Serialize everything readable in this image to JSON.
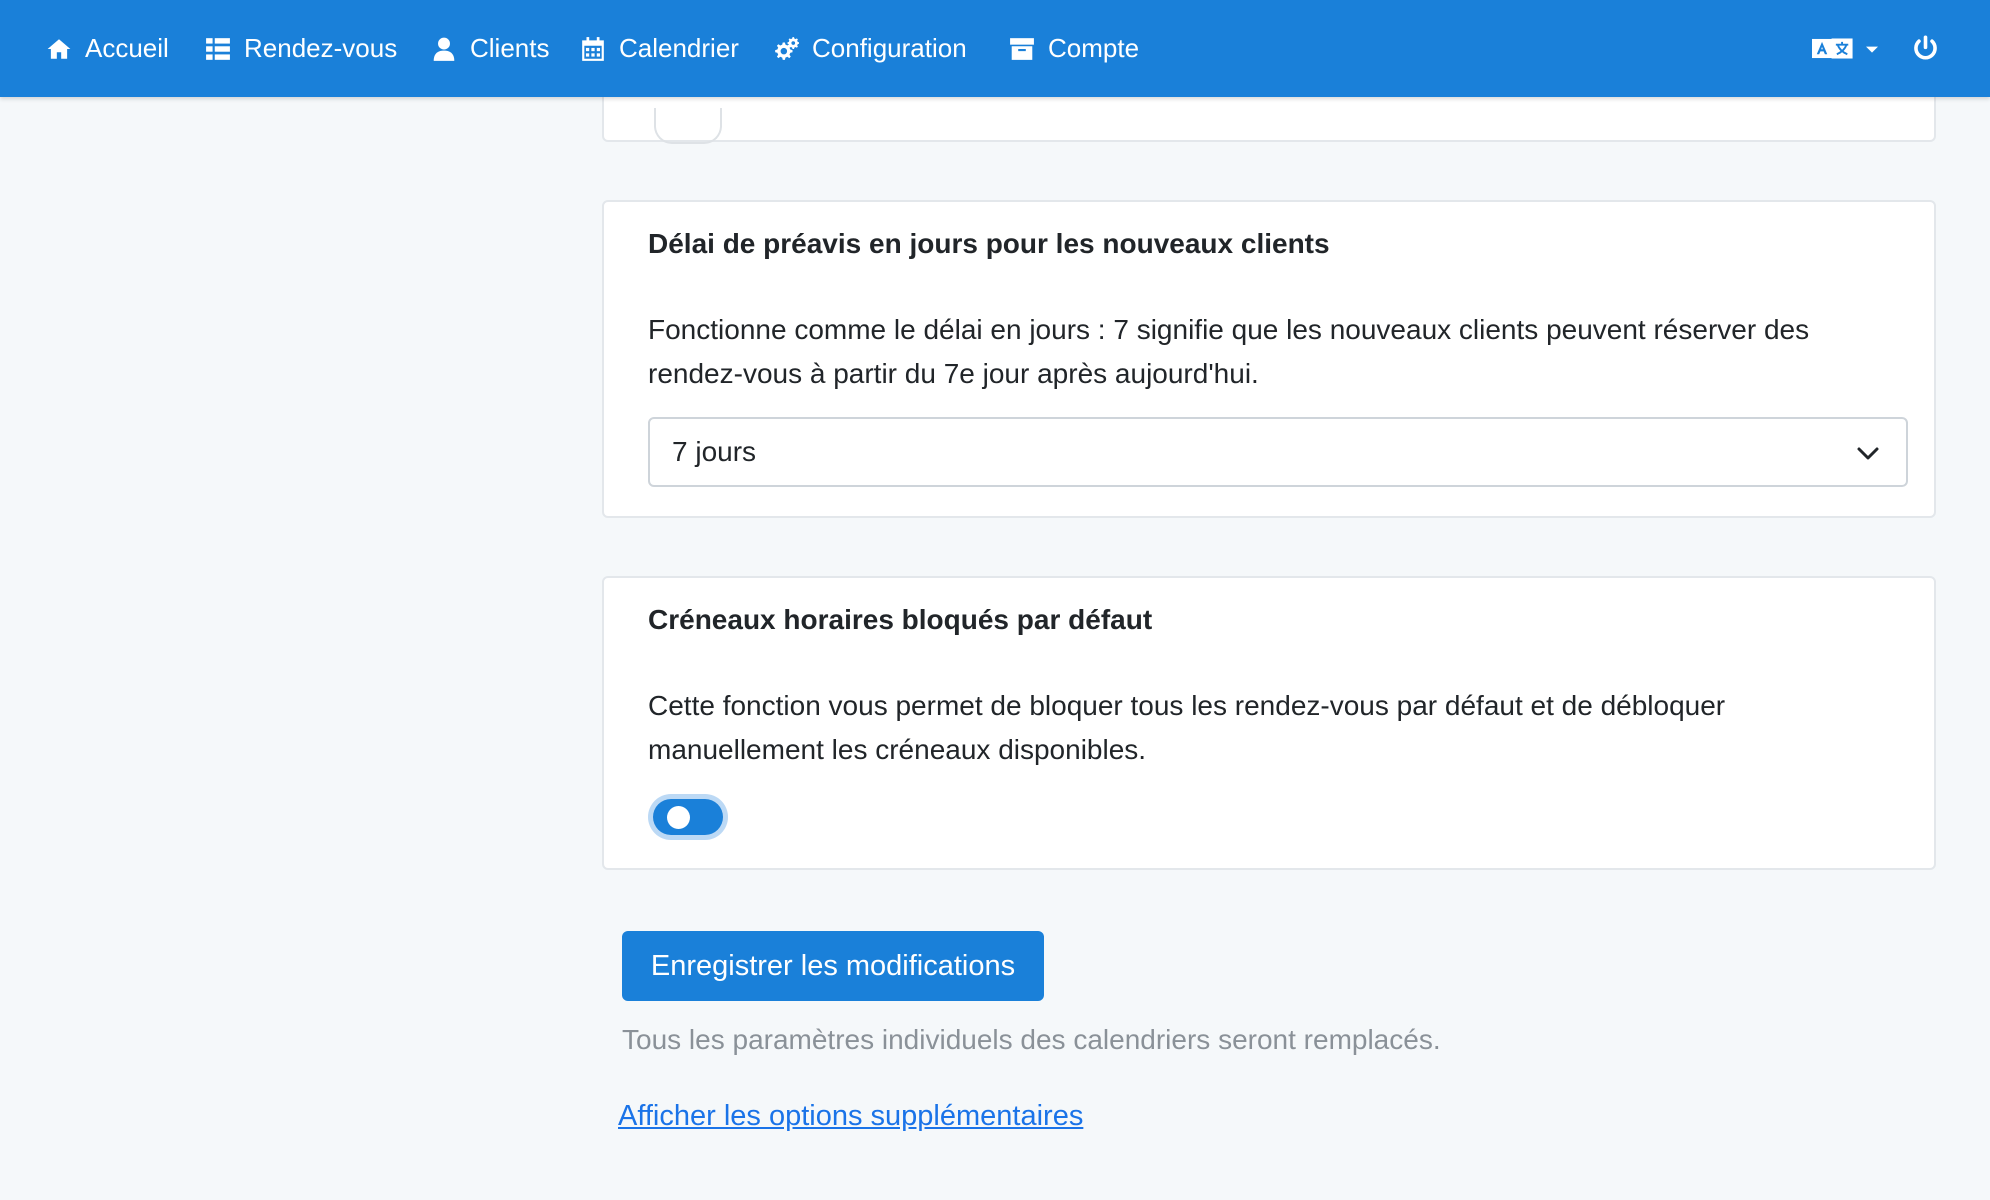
{
  "nav": {
    "items": [
      {
        "label": "Accueil",
        "icon": "home-icon"
      },
      {
        "label": "Rendez-vous",
        "icon": "list-icon"
      },
      {
        "label": "Clients",
        "icon": "user-icon"
      },
      {
        "label": "Calendrier",
        "icon": "calendar-icon"
      },
      {
        "label": "Configuration",
        "icon": "gears-icon"
      },
      {
        "label": "Compte",
        "icon": "archive-box-icon"
      }
    ],
    "language_icon": "translate-icon",
    "logout_icon": "power-icon"
  },
  "sections": {
    "notice_new_clients": {
      "title": "Délai de préavis en jours pour les nouveaux clients",
      "description": "Fonctionne comme le délai en jours : 7 signifie que les nouveaux clients peuvent réserver des rendez-vous à partir du 7e jour après aujourd'hui.",
      "selected_value": "7 jours"
    },
    "blocked_slots": {
      "title": "Créneaux horaires bloqués par défaut",
      "description": "Cette fonction vous permet de bloquer tous les rendez-vous par défaut et de débloquer manuellement les créneaux disponibles.",
      "toggle_on": true
    }
  },
  "footer": {
    "save_label": "Enregistrer les modifications",
    "hint": "Tous les paramètres individuels des calendriers seront remplacés.",
    "more_options_label": "Afficher les options supplémentaires"
  },
  "colors": {
    "primary": "#1a80d9",
    "background": "#f5f8fa",
    "link": "#1a73e8"
  }
}
